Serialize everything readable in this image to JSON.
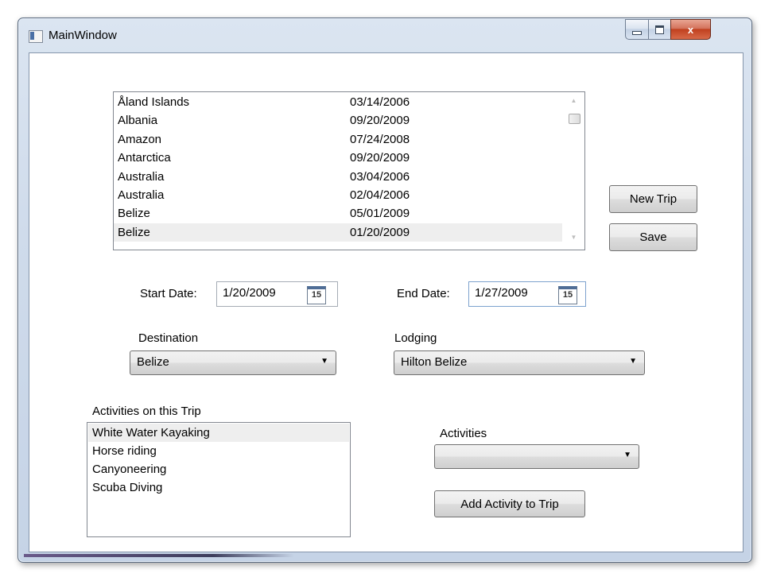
{
  "window": {
    "title": "MainWindow",
    "min_glyph": "",
    "max_glyph": "",
    "close_glyph": "x"
  },
  "trips": {
    "rows": [
      {
        "name": "Åland Islands",
        "date": "03/14/2006"
      },
      {
        "name": "Albania",
        "date": "09/20/2009"
      },
      {
        "name": "Amazon",
        "date": "07/24/2008"
      },
      {
        "name": "Antarctica",
        "date": "09/20/2009"
      },
      {
        "name": "Australia",
        "date": "03/04/2006"
      },
      {
        "name": "Australia",
        "date": "02/04/2006"
      },
      {
        "name": "Belize",
        "date": "05/01/2009"
      },
      {
        "name": "Belize",
        "date": "01/20/2009"
      }
    ],
    "selected_index": 7
  },
  "buttons": {
    "new_trip": "New Trip",
    "save": "Save",
    "add_activity": "Add Activity to Trip"
  },
  "start_date": {
    "label": "Start Date:",
    "value": "1/20/2009",
    "calendar_day": "15"
  },
  "end_date": {
    "label": "End Date:",
    "value": "1/27/2009",
    "calendar_day": "15"
  },
  "destination": {
    "label": "Destination",
    "value": "Belize"
  },
  "lodging": {
    "label": "Lodging",
    "value": "Hilton Belize"
  },
  "trip_activities": {
    "label": "Activities on this Trip",
    "items": [
      "White Water Kayaking",
      "Horse riding",
      "Canyoneering",
      "Scuba Diving"
    ],
    "selected_index": 0
  },
  "activities": {
    "label": "Activities",
    "value": ""
  },
  "icons": {
    "window_icon": "app-window-icon",
    "calendar": "calendar-icon",
    "dropdown": "chevron-down-icon",
    "close": "close-icon",
    "minimize": "minimize-icon",
    "maximize": "maximize-icon"
  },
  "colors": {
    "selection_bg": "#eeeeee",
    "close_button": "#c0401f",
    "window_frame": "#cfdbeb"
  }
}
